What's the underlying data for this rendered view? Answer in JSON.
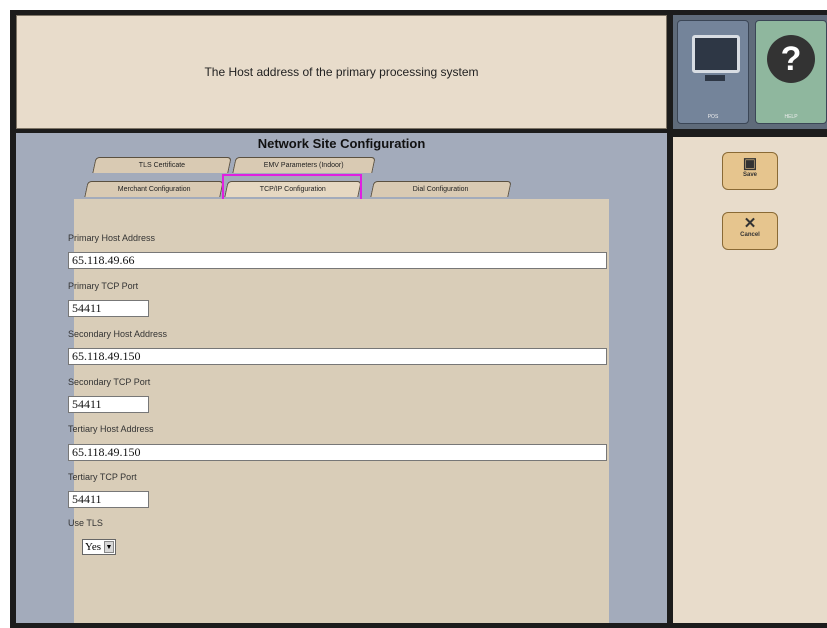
{
  "info_text": "The Host address of the primary processing system",
  "top_buttons": {
    "pos_label": "POS",
    "help_label": "HELP",
    "help_glyph": "?"
  },
  "title": "Network Site Configuration",
  "tabs": [
    {
      "label": "TLS Certificate"
    },
    {
      "label": "EMV Parameters (Indoor)"
    },
    {
      "label": "Merchant Configuration"
    },
    {
      "label": "TCP/IP Configuration",
      "active": true
    },
    {
      "label": "Dial Configuration"
    }
  ],
  "fields": {
    "primary_host": {
      "label": "Primary Host Address",
      "value": "65.118.49.66"
    },
    "primary_port": {
      "label": "Primary TCP Port",
      "value": "54411"
    },
    "secondary_host": {
      "label": "Secondary Host Address",
      "value": "65.118.49.150"
    },
    "secondary_port": {
      "label": "Secondary TCP Port",
      "value": "54411"
    },
    "tertiary_host": {
      "label": "Tertiary Host Address",
      "value": "65.118.49.150"
    },
    "tertiary_port": {
      "label": "Tertiary TCP Port",
      "value": "54411"
    },
    "use_tls": {
      "label": "Use TLS",
      "value": "Yes"
    }
  },
  "actions": {
    "save_label": "Save",
    "cancel_label": "Cancel"
  },
  "icons": {
    "save": "floppy-disk-icon",
    "cancel": "x-icon",
    "pos": "monitor-icon",
    "help": "question-mark-icon"
  },
  "colors": {
    "highlight": "#e020e0",
    "panel_bg": "#e8dccb",
    "main_bg": "#a3abbb"
  }
}
